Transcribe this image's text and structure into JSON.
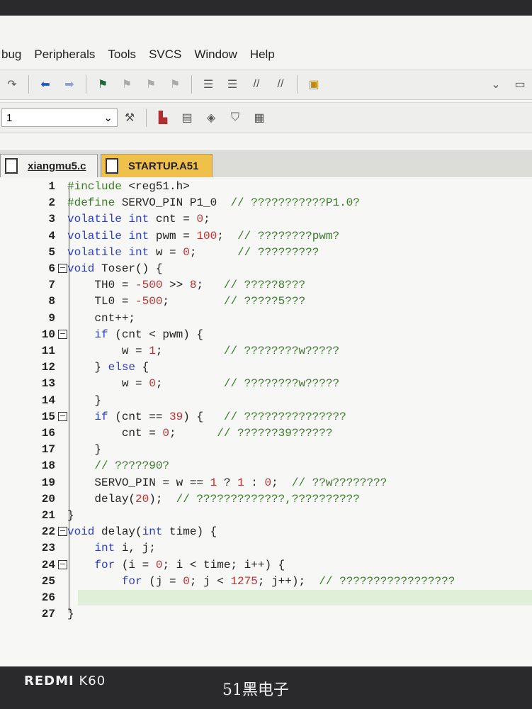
{
  "menu": [
    "bug",
    "Peripherals",
    "Tools",
    "SVCS",
    "Window",
    "Help"
  ],
  "toolbar2": {
    "combo_value": "1"
  },
  "tabs": [
    {
      "label": "xiangmu5.c"
    },
    {
      "label": "STARTUP.A51"
    }
  ],
  "editor": {
    "lines": [
      {
        "n": "1",
        "text": "#include <reg51.h>"
      },
      {
        "n": "2",
        "text": "#define SERVO_PIN P1_0  // ???????????P1.0?"
      },
      {
        "n": "3",
        "text": "volatile int cnt = 0;"
      },
      {
        "n": "4",
        "text": "volatile int pwm = 100;  // ????????pwm?"
      },
      {
        "n": "5",
        "text": "volatile int w = 0;      // ?????????"
      },
      {
        "n": "6",
        "text": "void Toser() {"
      },
      {
        "n": "7",
        "text": "    TH0 = -500 >> 8;   // ?????8???"
      },
      {
        "n": "8",
        "text": "    TL0 = -500;        // ?????5???"
      },
      {
        "n": "9",
        "text": "    cnt++;"
      },
      {
        "n": "10",
        "text": "    if (cnt < pwm) {"
      },
      {
        "n": "11",
        "text": "        w = 1;         // ????????w?????"
      },
      {
        "n": "12",
        "text": "    } else {"
      },
      {
        "n": "13",
        "text": "        w = 0;         // ????????w?????"
      },
      {
        "n": "14",
        "text": "    }"
      },
      {
        "n": "15",
        "text": "    if (cnt == 39) {   // ???????????????"
      },
      {
        "n": "16",
        "text": "        cnt = 0;      // ??????39??????"
      },
      {
        "n": "17",
        "text": "    }"
      },
      {
        "n": "18",
        "text": "    // ?????90?"
      },
      {
        "n": "19",
        "text": "    SERVO_PIN = w == 1 ? 1 : 0;  // ??w????????"
      },
      {
        "n": "20",
        "text": "    delay(20);  // ?????????????,??????????"
      },
      {
        "n": "21",
        "text": "}"
      },
      {
        "n": "22",
        "text": "void delay(int time) {"
      },
      {
        "n": "23",
        "text": "    int i, j;"
      },
      {
        "n": "24",
        "text": "    for (i = 0; i < time; i++) {"
      },
      {
        "n": "25",
        "text": "        for (j = 0; j < 1275; j++);  // ?????????????????"
      },
      {
        "n": "26",
        "text": "    }"
      },
      {
        "n": "27",
        "text": "}"
      }
    ]
  },
  "watermark": {
    "brand": "REDMI",
    "model": "K60",
    "center": "51黑电子"
  }
}
